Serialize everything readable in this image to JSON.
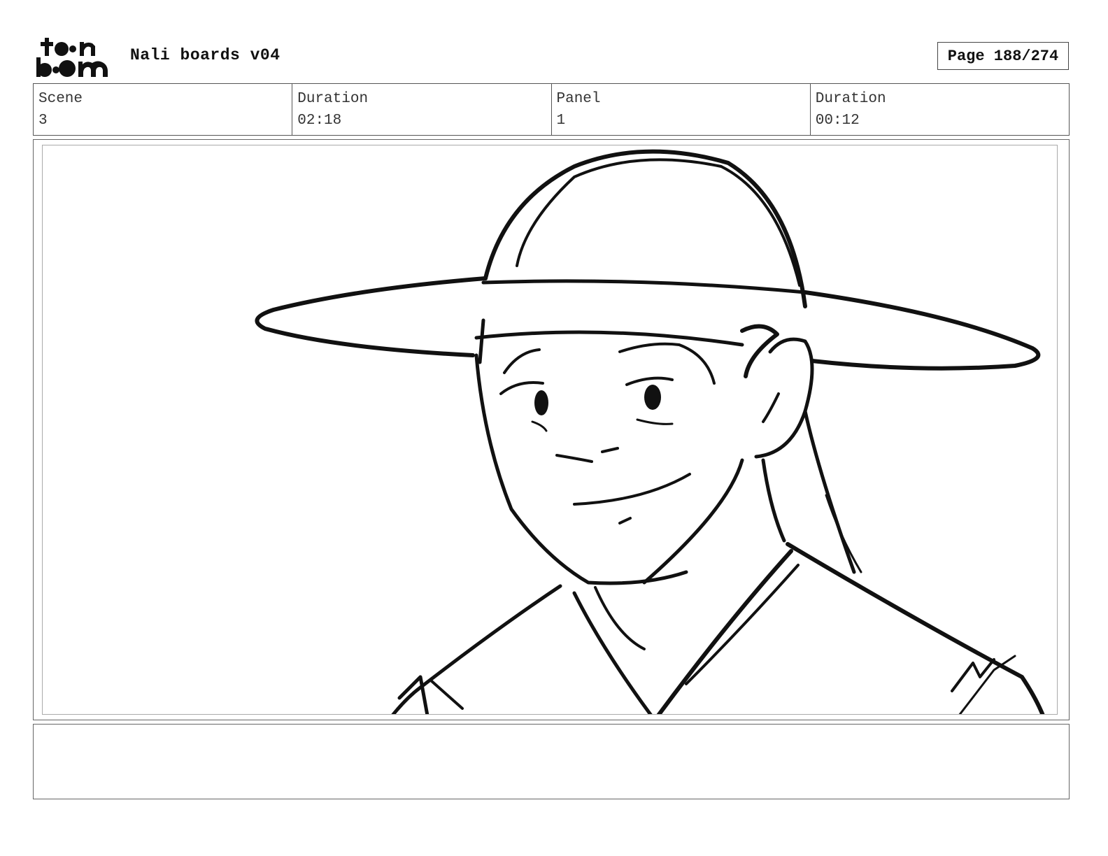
{
  "header": {
    "logo_text": "toon boom",
    "project_title": "Nali boards v04",
    "page_label": "Page 188/274"
  },
  "info": [
    {
      "label": "Scene",
      "value": "3"
    },
    {
      "label": "Duration",
      "value": "02:18"
    },
    {
      "label": "Panel",
      "value": "1"
    },
    {
      "label": "Duration",
      "value": "00:12"
    }
  ],
  "panel": {
    "drawing": "sketch-character-wide-brim-hat"
  },
  "notes": {
    "text": ""
  }
}
